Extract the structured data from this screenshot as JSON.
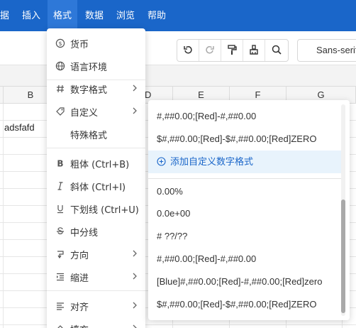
{
  "menubar": {
    "items": [
      "据",
      "插入",
      "格式",
      "数据",
      "浏览",
      "帮助"
    ],
    "active_index": 2,
    "color": "#1a66c9"
  },
  "toolbar": {
    "buttons": [
      {
        "icon": "undo-icon"
      },
      {
        "icon": "redo-icon"
      },
      {
        "icon": "paint-format-icon"
      },
      {
        "icon": "clear-format-icon"
      },
      {
        "icon": "search-icon"
      }
    ],
    "font_family": "Sans-serif"
  },
  "sheet": {
    "columns": [
      "B",
      "",
      "D",
      "E",
      "F",
      "G"
    ],
    "cell_b": "adsfafd"
  },
  "format_menu": {
    "items": [
      {
        "label": "货币",
        "icon": "currency-icon",
        "submenu": false
      },
      {
        "label": "语言环境",
        "icon": "globe-icon",
        "submenu": false
      },
      {
        "label": "数字格式",
        "icon": "hash-icon",
        "submenu": true
      },
      {
        "label": "自定义",
        "icon": "tag-icon",
        "submenu": true
      },
      {
        "label": "特殊格式",
        "icon": "",
        "submenu": false
      },
      {
        "label": "粗体 (Ctrl+B)",
        "icon": "bold-icon",
        "submenu": false
      },
      {
        "label": "斜体 (Ctrl+I)",
        "icon": "italic-icon",
        "submenu": false
      },
      {
        "label": "下划线 (Ctrl+U)",
        "icon": "underline-icon",
        "submenu": false
      },
      {
        "label": "中分线",
        "icon": "strikethrough-icon",
        "submenu": false
      },
      {
        "label": "方向",
        "icon": "direction-icon",
        "submenu": true
      },
      {
        "label": "缩进",
        "icon": "indent-icon",
        "submenu": true
      },
      {
        "label": "对齐",
        "icon": "align-icon",
        "submenu": true
      },
      {
        "label": "填充",
        "icon": "fill-icon",
        "submenu": true
      }
    ]
  },
  "custom_submenu": {
    "items": [
      "#,##0.00;[Red]-#,##0.00",
      "$#,##0.00;[Red]-$#,##0.00;[Red]ZERO",
      "添加自定义数字格式",
      "0.00%",
      "0.0e+00",
      "# ??/??",
      "#,##0.00;[Red]-#,##0.00",
      "[Blue]#,##0.00;[Red]-#,##0.00;[Red]zero",
      "$#,##0.00;[Red]-$#,##0.00;[Red]ZERO"
    ],
    "highlight_color": "#e8f3fc",
    "accent": "#1a66c9"
  }
}
